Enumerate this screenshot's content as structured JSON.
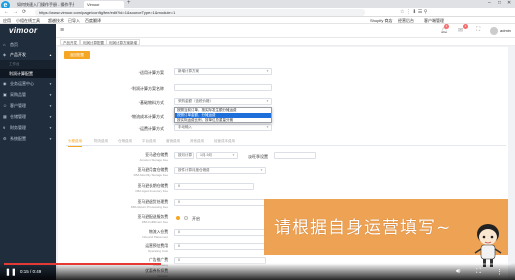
{
  "browser": {
    "logo": "e",
    "tabs": [
      "如何快速入门操作手册 - 操作手册",
      "Vimoor"
    ],
    "url": "https://www.vimoor.com/page/config/fee/edit?id=1&sourceType=1&module=1",
    "bookmarks": [
      "应用",
      "小组在线工具",
      "超越技术",
      "已导入",
      "百度翻译",
      "Shopify 商店",
      "经营后台",
      "客户端管理"
    ],
    "nav": [
      "←",
      "→",
      "⟳"
    ]
  },
  "header": {
    "logo": "vimoor",
    "menu_icon": "≡",
    "notif_count": "4",
    "msg_count": "1",
    "user": "admin"
  },
  "sidebar": {
    "items": [
      {
        "label": "首页",
        "icon": "⌂"
      },
      {
        "label": "产品开发",
        "icon": "◈"
      },
      {
        "label": "工作台",
        "icon": "▤"
      },
      {
        "label": "利润计算配置",
        "icon": ""
      },
      {
        "label": "业务运营中心",
        "icon": "◉"
      },
      {
        "label": "采购品管",
        "icon": "▣"
      },
      {
        "label": "客户管理",
        "icon": "☺"
      },
      {
        "label": "仓储管理",
        "icon": "▦"
      },
      {
        "label": "财务管理",
        "icon": "¥"
      },
      {
        "label": "系统配置",
        "icon": "⚙"
      }
    ]
  },
  "breadcrumbs": [
    "产品开发",
    "利润计算配置",
    "利润计算方案新增"
  ],
  "form": {
    "back_label": "返回配置",
    "fields": [
      {
        "label": "适用计算方案",
        "value": "新增计算方案"
      },
      {
        "label": "利润计算方案名称",
        "value": ""
      },
      {
        "label": "基础物料方式",
        "value": "采购金额（含税价格）"
      },
      {
        "label": "物流成本计算方式",
        "value": ""
      },
      {
        "label": "运费计算方式",
        "value": "手动输入"
      }
    ],
    "dropdown_options": [
      "按照当前订单，按实际发生额分摊运费",
      "按照订单金额，分摊运费",
      "按实际运费比例，按单位总重量分摊"
    ]
  },
  "tabs": [
    "头程费用",
    "物流费用",
    "仓储费用",
    "平台费用",
    "营销费用",
    "其他费用",
    "经营成本费用"
  ],
  "cost_rows": [
    {
      "label": "亚马逊仓储费",
      "sub": "Amazon Storage Fee",
      "value": "按月计算",
      "extra": "1月-9月",
      "extra2": "淡旺季设置"
    },
    {
      "label": "亚马逊月度仓储费",
      "sub": "FBA Monthly Storage Fee",
      "value": "按件计算月度仓储费"
    },
    {
      "label": "亚马逊长期仓储费",
      "sub": "FBA Aged Inventory Fee",
      "value": "0"
    },
    {
      "label": "亚马逊退货处理费",
      "sub": "FBA Return Processing Fee",
      "value": "0"
    },
    {
      "label": "亚马逊配送服务费",
      "sub": "FBA Fulfillment Fee",
      "value": "开启"
    },
    {
      "label": "物流入仓费",
      "sub": "Inbound Placement",
      "value": "0"
    },
    {
      "label": "运营预估费用",
      "sub": "Operating Cost",
      "value": "0"
    },
    {
      "label": "广告推广费",
      "sub": "Advertising",
      "value": "0"
    },
    {
      "label": "优惠券折扣费",
      "sub": "Coupon",
      "value": "0"
    }
  ],
  "overlay": {
    "caption": "请根据自身运营填写~"
  },
  "video": {
    "current_time": "0:15",
    "duration": "0:49",
    "progress": 0.31,
    "accent": "#e53935"
  },
  "colors": {
    "sidebar_bg": "#1f2d3d",
    "primary": "#f5a623",
    "dropdown_highlight": "#1e6fd9"
  }
}
